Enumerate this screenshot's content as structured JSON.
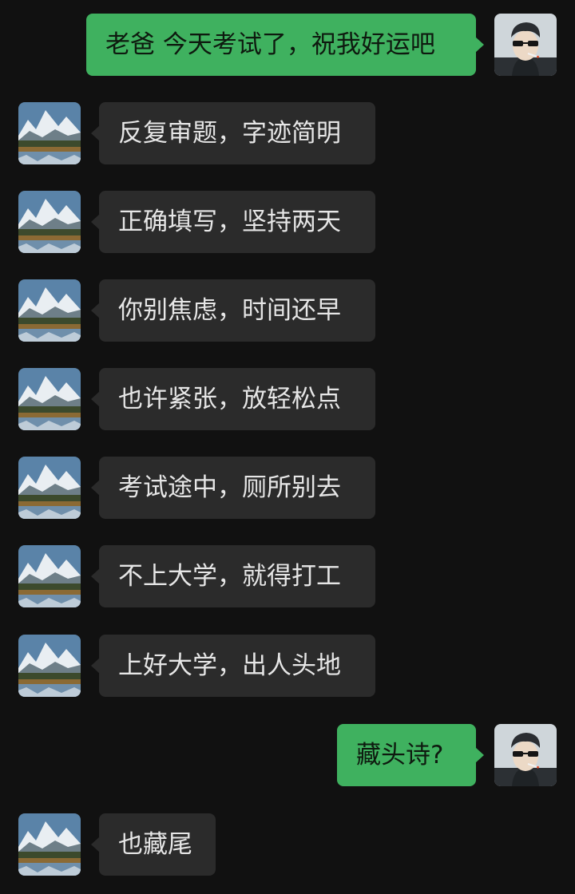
{
  "conversation": {
    "me_avatar": "cartoon-man-sunglasses-cigarette-avatar",
    "dad_avatar": "mountain-lake-landscape-avatar",
    "messages": [
      {
        "sender": "me",
        "text": "老爸 今天考试了，祝我好运吧"
      },
      {
        "sender": "dad",
        "text": "反复审题，字迹简明"
      },
      {
        "sender": "dad",
        "text": "正确填写，坚持两天"
      },
      {
        "sender": "dad",
        "text": "你别焦虑，时间还早"
      },
      {
        "sender": "dad",
        "text": "也许紧张，放轻松点"
      },
      {
        "sender": "dad",
        "text": "考试途中，厕所别去"
      },
      {
        "sender": "dad",
        "text": "不上大学，就得打工"
      },
      {
        "sender": "dad",
        "text": "上好大学，出人头地"
      },
      {
        "sender": "me",
        "text": "藏头诗?"
      },
      {
        "sender": "dad",
        "text": "也藏尾"
      }
    ]
  },
  "colors": {
    "background": "#111111",
    "incoming_bubble": "#2b2b2b",
    "outgoing_bubble": "#3fb15f"
  }
}
